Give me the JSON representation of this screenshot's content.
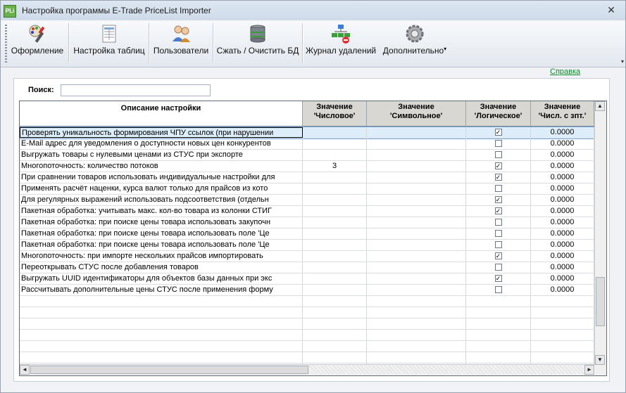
{
  "window": {
    "title": "Настройка программы E-Trade PriceList Importer",
    "app_icon_text": "PLi",
    "close_glyph": "✕"
  },
  "toolbar": {
    "buttons": [
      {
        "label": "Оформление",
        "icon": "design-brush-icon"
      },
      {
        "label": "Настройка таблиц",
        "icon": "table-settings-icon"
      },
      {
        "label": "Пользователи",
        "icon": "users-icon"
      },
      {
        "label": "Сжать / Очистить БД",
        "icon": "database-icon"
      },
      {
        "label": "Журнал удалений",
        "icon": "deletion-log-icon"
      },
      {
        "label": "Дополнительно",
        "icon": "gear-icon"
      }
    ]
  },
  "help_link": "Справка",
  "search": {
    "label": "Поиск:",
    "value": "",
    "placeholder": ""
  },
  "grid": {
    "columns": {
      "desc": "Описание настройки",
      "num": "Значение\n'Числовое'",
      "sym": "Значение\n'Символьное'",
      "log": "Значение\n'Логическое'",
      "dbl": "Значение\n'Числ. с зпт.'"
    },
    "rows": [
      {
        "desc": "Проверять уникальность формирования ЧПУ ссылок (при нарушении",
        "num": "",
        "sym": "",
        "log": true,
        "dbl": "0.0000",
        "selected": true
      },
      {
        "desc": "E-Mail адрес для уведомления о доступности новых цен конкурентов",
        "num": "",
        "sym": "",
        "log": false,
        "dbl": "0.0000"
      },
      {
        "desc": "Выгружать товары с нулевыми ценами из СТУС при экспорте",
        "num": "",
        "sym": "",
        "log": false,
        "dbl": "0.0000"
      },
      {
        "desc": "Многопоточность: количество потоков",
        "num": "3",
        "sym": "",
        "log": true,
        "dbl": "0.0000"
      },
      {
        "desc": "При сравнении товаров использовать индивидуальные настройки для",
        "num": "",
        "sym": "",
        "log": true,
        "dbl": "0.0000"
      },
      {
        "desc": "Применять расчёт наценки, курса валют только для прайсов из кото",
        "num": "",
        "sym": "",
        "log": false,
        "dbl": "0.0000"
      },
      {
        "desc": "Для регулярных выражений использовать подсоответствия (отдельн",
        "num": "",
        "sym": "",
        "log": true,
        "dbl": "0.0000"
      },
      {
        "desc": "Пакетная обработка: учитывать макс. кол-во товара из колонки СТИГ",
        "num": "",
        "sym": "",
        "log": true,
        "dbl": "0.0000"
      },
      {
        "desc": "Пакетная обработка: при поиске цены товара использовать закупочн",
        "num": "",
        "sym": "",
        "log": false,
        "dbl": "0.0000"
      },
      {
        "desc": "Пакетная обработка: при поиске цены товара использовать поле 'Це",
        "num": "",
        "sym": "",
        "log": false,
        "dbl": "0.0000"
      },
      {
        "desc": "Пакетная обработка: при поиске цены товара использовать поле 'Це",
        "num": "",
        "sym": "",
        "log": false,
        "dbl": "0.0000"
      },
      {
        "desc": "Многопоточность: при импорте нескольких прайсов импортировать",
        "num": "",
        "sym": "",
        "log": true,
        "dbl": "0.0000"
      },
      {
        "desc": "Переоткрывать СТУС после добавления товаров",
        "num": "",
        "sym": "",
        "log": false,
        "dbl": "0.0000"
      },
      {
        "desc": "Выгружать UUID идентификаторы для объектов базы данных при экс",
        "num": "",
        "sym": "",
        "log": true,
        "dbl": "0.0000"
      },
      {
        "desc": "Рассчитывать дополнительные цены СТУС после применения форму",
        "num": "",
        "sym": "",
        "log": false,
        "dbl": "0.0000"
      }
    ],
    "empty_rows": 8
  }
}
